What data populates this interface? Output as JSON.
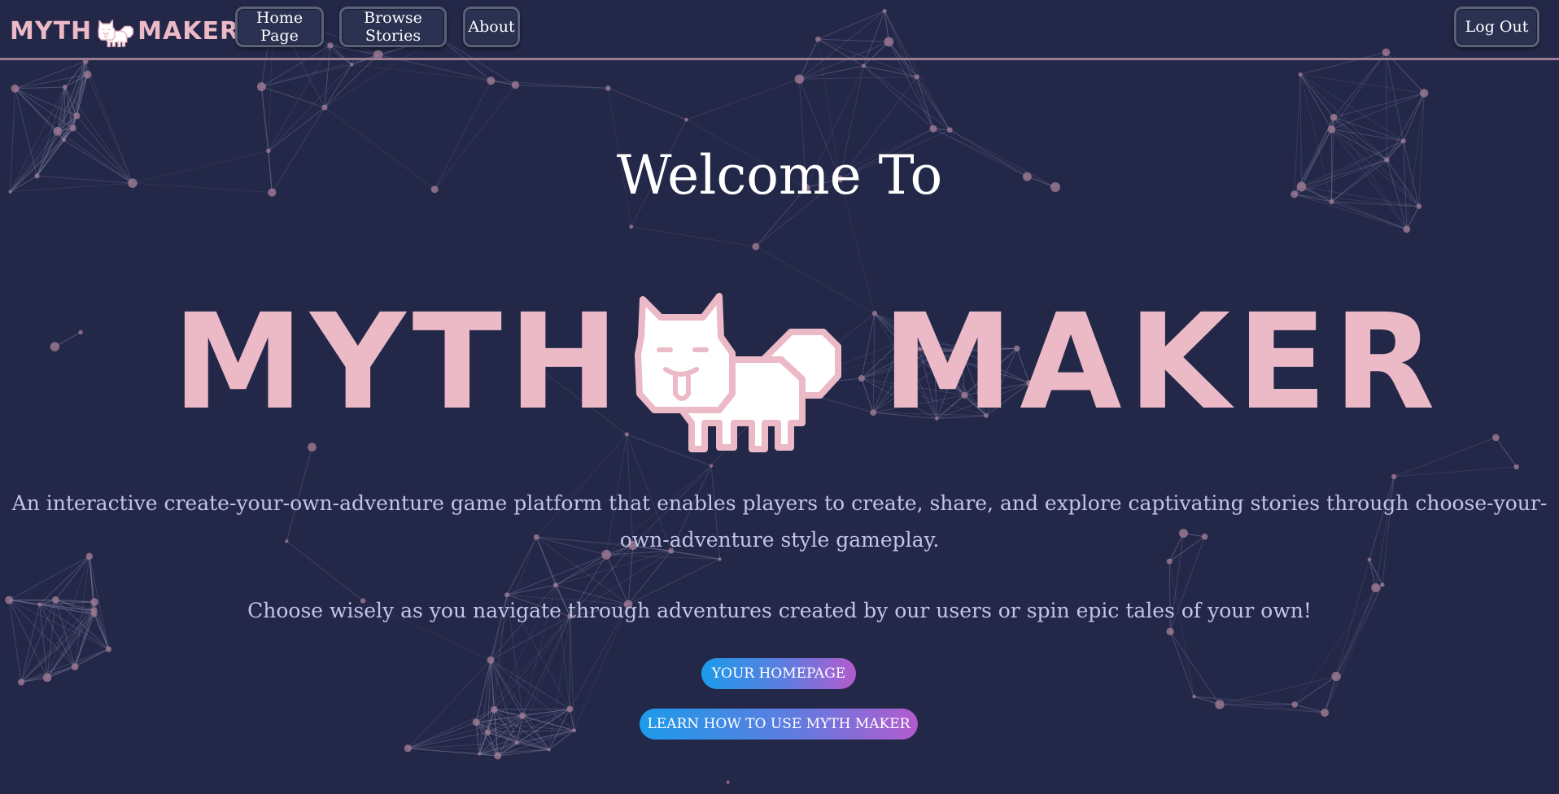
{
  "brand": {
    "left_word": "MYTH",
    "right_word": "MAKER"
  },
  "nav": {
    "home_label": "Home Page",
    "browse_label": "Browse Stories",
    "about_label": "About",
    "logout_label": "Log Out"
  },
  "hero": {
    "welcome": "Welcome To",
    "logo_left": "MYTH",
    "logo_right": "MAKER",
    "description": "An interactive create-your-own-adventure game platform that enables players to create, share, and explore captivating stories through choose-your-own-adventure style gameplay.",
    "tagline": "Choose wisely as you navigate through adventures created by our users or spin epic tales of your own!",
    "cta_homepage": "YOUR HOMEPAGE",
    "cta_learn": "LEARN HOW TO USE MYTH MAKER"
  },
  "colors": {
    "background": "#242848",
    "accent_pink": "#ecb9c6",
    "text_light": "#c6c2e8",
    "gradient_start": "#1c9bea",
    "gradient_end": "#b35bcd"
  },
  "icons": {
    "brand_mascot": "white-cat-mascot-icon",
    "hero_mascot": "white-cat-mascot-icon"
  }
}
